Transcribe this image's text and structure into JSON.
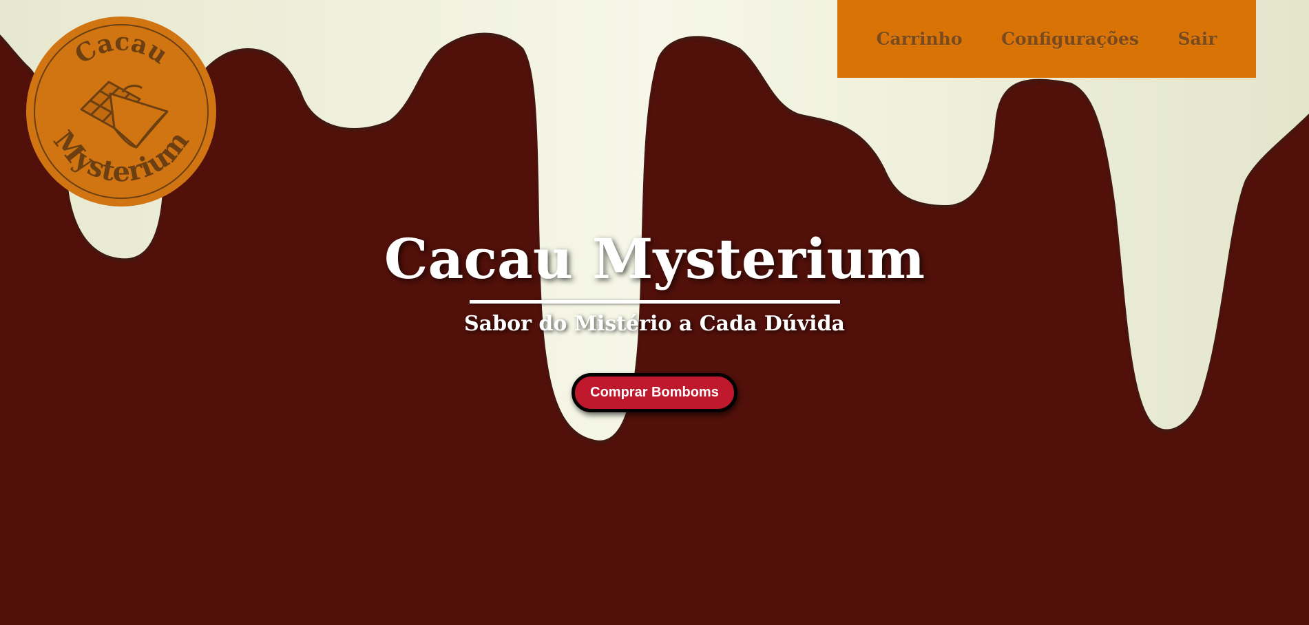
{
  "brand": {
    "logo_top": "Cacau",
    "logo_bottom": "Mysterium"
  },
  "nav": {
    "items": [
      {
        "label": "Carrinho"
      },
      {
        "label": "Configurações"
      },
      {
        "label": "Sair"
      }
    ]
  },
  "hero": {
    "title": "Cacau Mysterium",
    "subtitle": "Sabor do Mistério a Cada Dúvida",
    "cta_label": "Comprar Bomboms"
  },
  "colors": {
    "background": "#52100a",
    "white_chocolate": "#f0f1de",
    "nav_background": "#d97306",
    "nav_text": "#7a4a1d",
    "logo_fill": "#d07512",
    "logo_ink": "#6b3f12",
    "cta_background": "#c0182c"
  },
  "icons": {
    "logo_illustration": "chocolate-bar-icon"
  }
}
